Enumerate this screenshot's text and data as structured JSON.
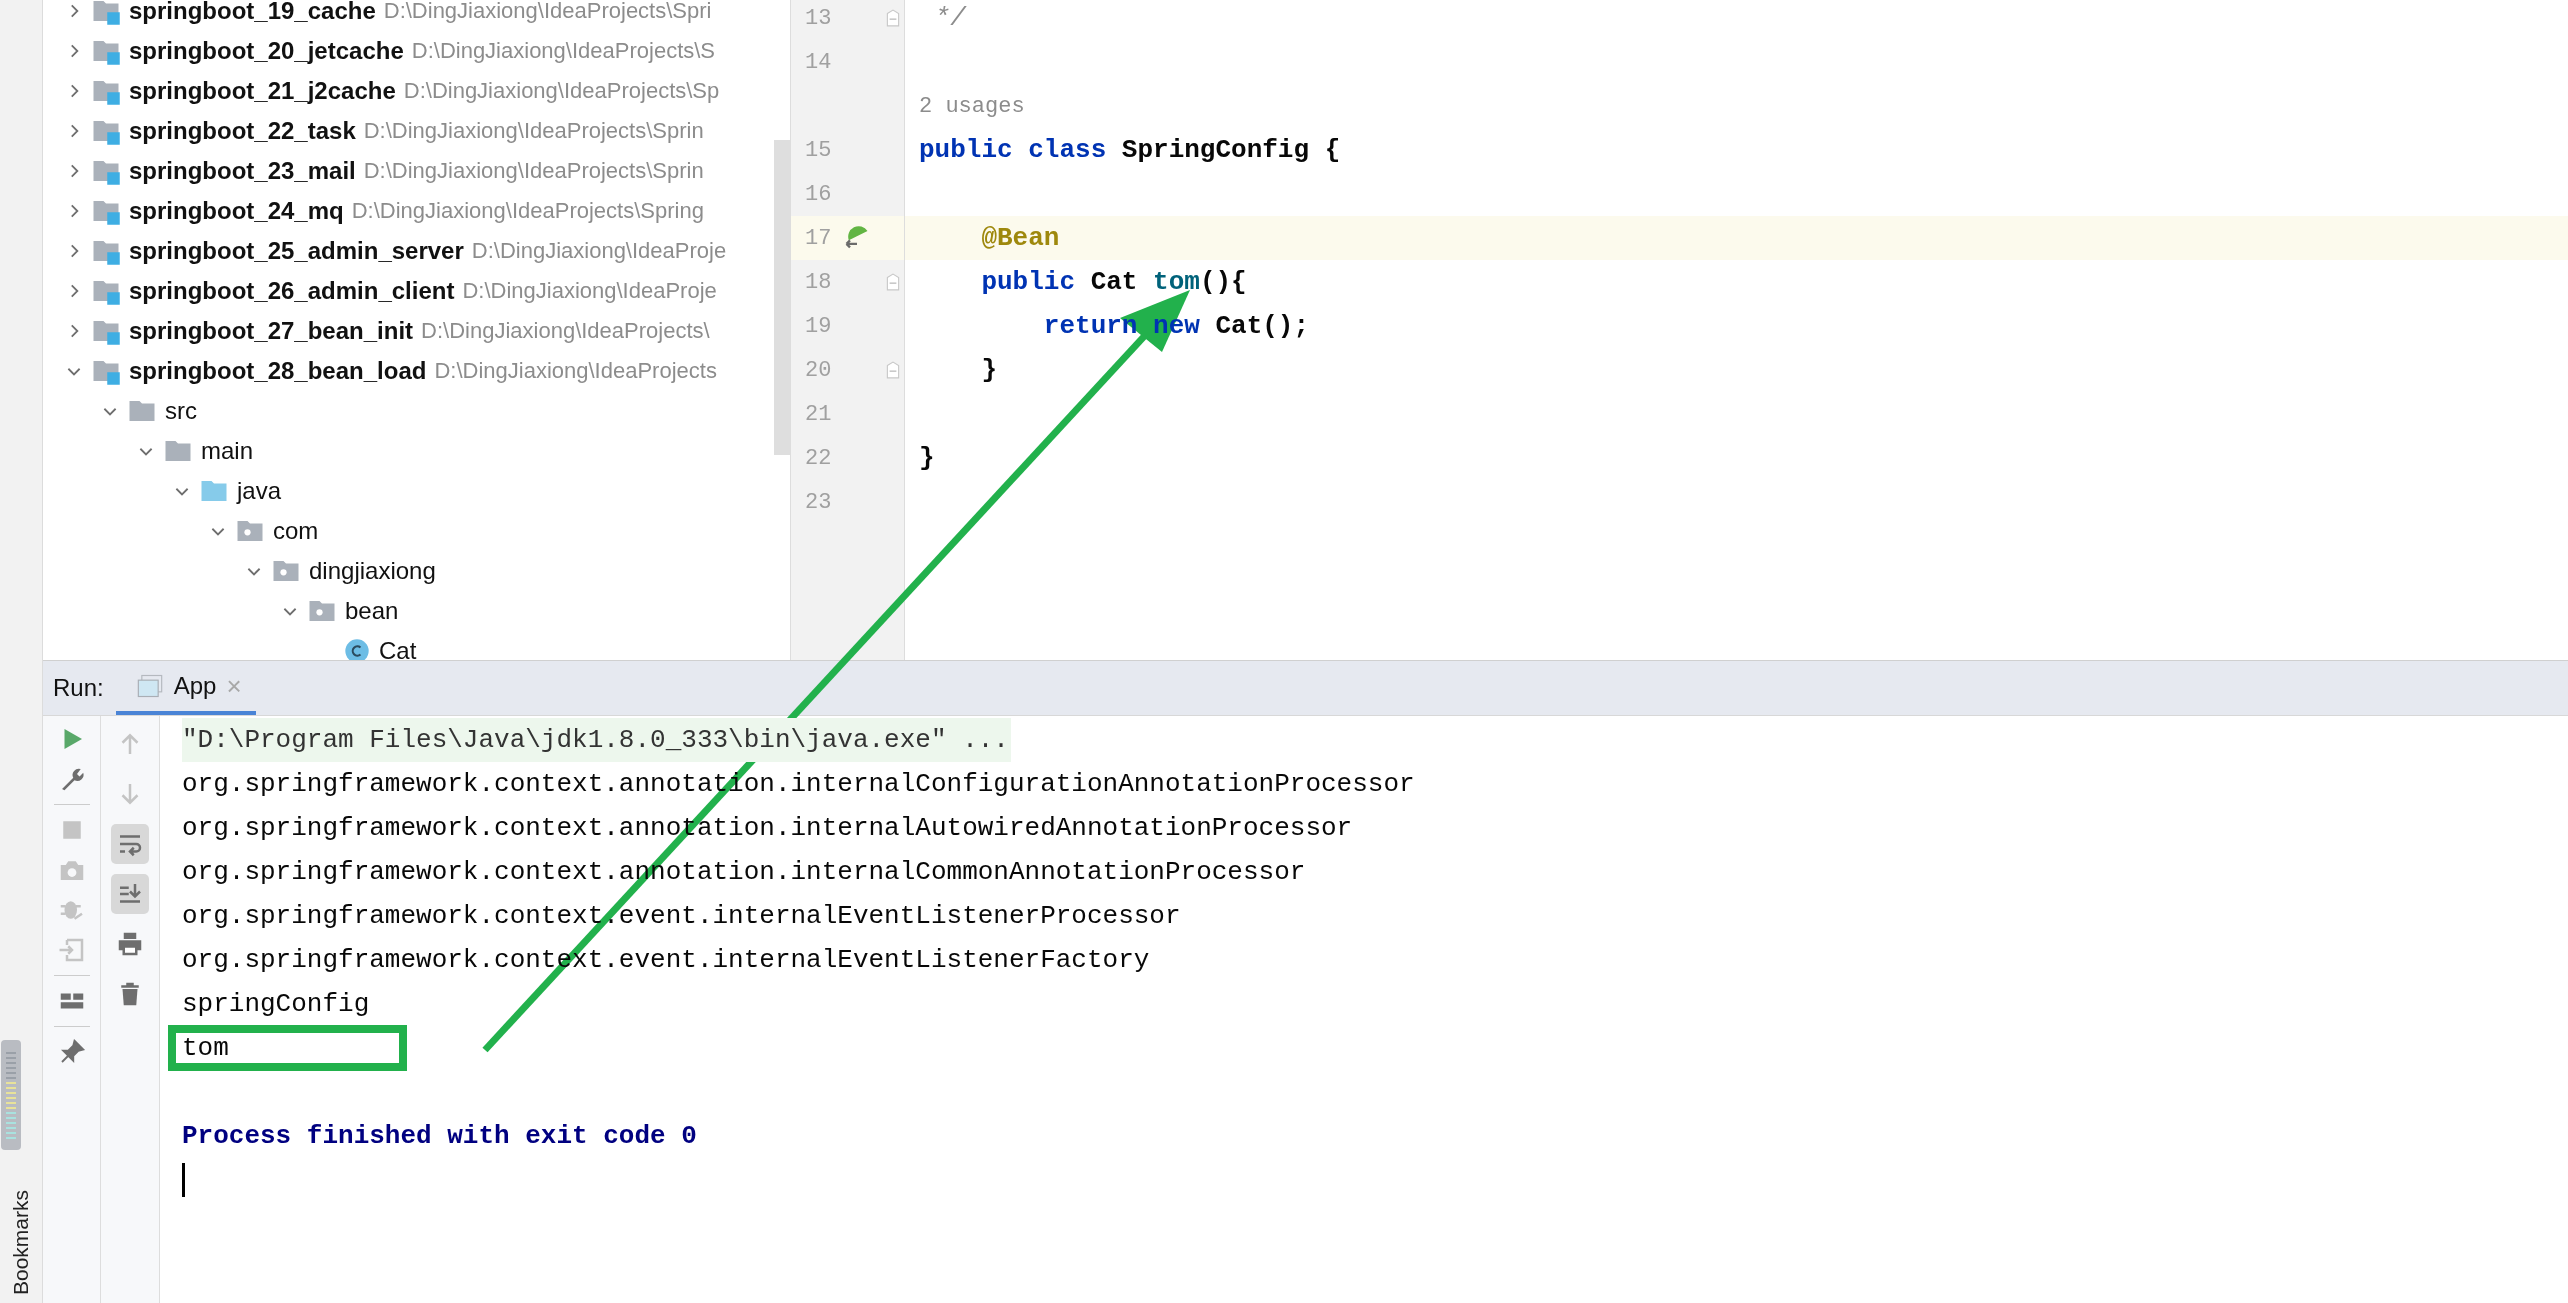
{
  "project_tree": [
    {
      "name": "springboot_19_cache",
      "path": "D:\\DingJiaxiong\\IdeaProjects\\Spri",
      "kind": "module",
      "expanded": false
    },
    {
      "name": "springboot_20_jetcache",
      "path": "D:\\DingJiaxiong\\IdeaProjects\\S",
      "kind": "module",
      "expanded": false
    },
    {
      "name": "springboot_21_j2cache",
      "path": "D:\\DingJiaxiong\\IdeaProjects\\Sp",
      "kind": "module",
      "expanded": false
    },
    {
      "name": "springboot_22_task",
      "path": "D:\\DingJiaxiong\\IdeaProjects\\Sprin",
      "kind": "module",
      "expanded": false
    },
    {
      "name": "springboot_23_mail",
      "path": "D:\\DingJiaxiong\\IdeaProjects\\Sprin",
      "kind": "module",
      "expanded": false
    },
    {
      "name": "springboot_24_mq",
      "path": "D:\\DingJiaxiong\\IdeaProjects\\Spring",
      "kind": "module",
      "expanded": false
    },
    {
      "name": "springboot_25_admin_server",
      "path": "D:\\DingJiaxiong\\IdeaProje",
      "kind": "module",
      "expanded": false
    },
    {
      "name": "springboot_26_admin_client",
      "path": "D:\\DingJiaxiong\\IdeaProje",
      "kind": "module",
      "expanded": false
    },
    {
      "name": "springboot_27_bean_init",
      "path": "D:\\DingJiaxiong\\IdeaProjects\\",
      "kind": "module",
      "expanded": false
    },
    {
      "name": "springboot_28_bean_load",
      "path": "D:\\DingJiaxiong\\IdeaProjects",
      "kind": "module",
      "expanded": true,
      "children": [
        {
          "name": "src",
          "kind": "folder",
          "expanded": true,
          "children": [
            {
              "name": "main",
              "kind": "folder",
              "expanded": true,
              "children": [
                {
                  "name": "java",
                  "kind": "source",
                  "expanded": true,
                  "children": [
                    {
                      "name": "com",
                      "kind": "package",
                      "expanded": true,
                      "children": [
                        {
                          "name": "dingjiaxiong",
                          "kind": "package",
                          "expanded": true,
                          "children": [
                            {
                              "name": "bean",
                              "kind": "package",
                              "expanded": true,
                              "children": [
                                {
                                  "name": "Cat",
                                  "kind": "class"
                                }
                              ]
                            }
                          ]
                        }
                      ]
                    }
                  ]
                }
              ]
            }
          ]
        }
      ]
    }
  ],
  "editor": {
    "lines": [
      {
        "kind": "code",
        "number": "13",
        "fold": true,
        "current": false,
        "bean_marker": false,
        "tokens": [
          {
            "kind": "comment",
            "text": " */"
          }
        ]
      },
      {
        "kind": "code",
        "number": "14",
        "fold": false,
        "current": false,
        "bean_marker": false
      },
      {
        "kind": "hint",
        "text": "2 usages"
      },
      {
        "kind": "code",
        "number": "15",
        "fold": false,
        "current": false,
        "bean_marker": false,
        "tokens": [
          {
            "kind": "keyword",
            "text": "public class "
          },
          {
            "kind": "plain",
            "text": "SpringConfig {"
          }
        ]
      },
      {
        "kind": "code",
        "number": "16",
        "fold": false,
        "current": false,
        "bean_marker": false
      },
      {
        "kind": "code",
        "number": "17",
        "fold": false,
        "current": true,
        "bean_marker": true,
        "tokens": [
          {
            "kind": "annotation",
            "text": "    @Bean"
          }
        ]
      },
      {
        "kind": "code",
        "number": "18",
        "fold": true,
        "current": false,
        "bean_marker": false,
        "tokens": [
          {
            "kind": "keyword",
            "text": "    public "
          },
          {
            "kind": "plain",
            "text": "Cat "
          },
          {
            "kind": "method",
            "text": "tom"
          },
          {
            "kind": "plain",
            "text": "(){"
          }
        ]
      },
      {
        "kind": "code",
        "number": "19",
        "fold": false,
        "current": false,
        "bean_marker": false,
        "tokens": [
          {
            "kind": "keyword",
            "text": "        return new "
          },
          {
            "kind": "plain",
            "text": "Cat();"
          }
        ]
      },
      {
        "kind": "code",
        "number": "20",
        "fold": true,
        "current": false,
        "bean_marker": false,
        "tokens": [
          {
            "kind": "plain",
            "text": "    }"
          }
        ]
      },
      {
        "kind": "code",
        "number": "21",
        "fold": false,
        "current": false,
        "bean_marker": false
      },
      {
        "kind": "code",
        "number": "22",
        "fold": false,
        "current": false,
        "bean_marker": false,
        "tokens": [
          {
            "kind": "plain",
            "text": "}"
          }
        ]
      },
      {
        "kind": "code",
        "number": "23",
        "fold": false,
        "current": false,
        "bean_marker": false
      }
    ]
  },
  "run_panel": {
    "label": "Run:",
    "tabs": [
      {
        "label": "App",
        "selected": true,
        "close": "×"
      }
    ],
    "run_tools": [
      {
        "kind": "run",
        "enabled": true
      },
      {
        "kind": "wrench",
        "enabled": true
      },
      {
        "kind": "separator"
      },
      {
        "kind": "stop",
        "enabled": false
      },
      {
        "kind": "camera",
        "enabled": false
      },
      {
        "kind": "debug",
        "enabled": false
      },
      {
        "kind": "attach",
        "enabled": false
      },
      {
        "kind": "separator"
      },
      {
        "kind": "layout",
        "enabled": true
      },
      {
        "kind": "separator"
      },
      {
        "kind": "pin",
        "enabled": true
      }
    ],
    "console_tools": [
      {
        "kind": "up",
        "toggled": false
      },
      {
        "kind": "down",
        "toggled": false
      },
      {
        "kind": "wrap",
        "toggled": true
      },
      {
        "kind": "scroll",
        "toggled": true
      },
      {
        "kind": "print",
        "toggled": false
      },
      {
        "kind": "trash",
        "toggled": false
      }
    ],
    "console": [
      {
        "kind": "command",
        "text": "\"D:\\Program Files\\Java\\jdk1.8.0_333\\bin\\java.exe\" ..."
      },
      {
        "kind": "output",
        "text": "org.springframework.context.annotation.internalConfigurationAnnotationProcessor",
        "highlighted": false
      },
      {
        "kind": "output",
        "text": "org.springframework.context.annotation.internalAutowiredAnnotationProcessor",
        "highlighted": false
      },
      {
        "kind": "output",
        "text": "org.springframework.context.annotation.internalCommonAnnotationProcessor",
        "highlighted": false
      },
      {
        "kind": "output",
        "text": "org.springframework.context.event.internalEventListenerProcessor",
        "highlighted": false
      },
      {
        "kind": "output",
        "text": "org.springframework.context.event.internalEventListenerFactory",
        "highlighted": false
      },
      {
        "kind": "output",
        "text": "springConfig",
        "highlighted": false
      },
      {
        "kind": "output",
        "text": "tom",
        "highlighted": true
      },
      {
        "kind": "blank"
      },
      {
        "kind": "exit",
        "text": "Process finished with exit code 0"
      },
      {
        "kind": "cursor"
      }
    ]
  },
  "side_bar": {
    "label": "Bookmarks"
  }
}
